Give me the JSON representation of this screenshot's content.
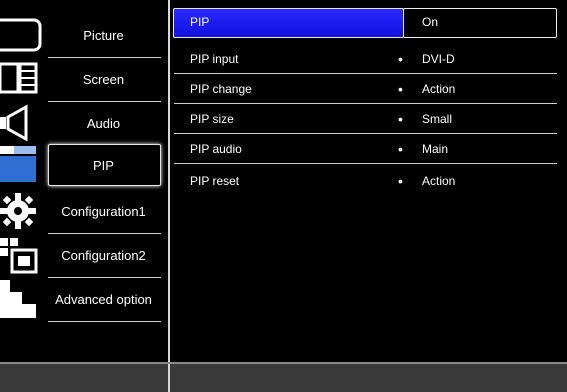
{
  "sidebar": {
    "items": [
      {
        "label": "Picture",
        "icon": "picture-icon"
      },
      {
        "label": "Screen",
        "icon": "screen-icon"
      },
      {
        "label": "Audio",
        "icon": "audio-icon"
      },
      {
        "label": "PIP",
        "icon": "pip-icon",
        "selected": true
      },
      {
        "label": "Configuration1",
        "icon": "gear-icon"
      },
      {
        "label": "Configuration2",
        "icon": "configuration2-icon"
      },
      {
        "label": "Advanced option",
        "icon": "advanced-option-icon"
      }
    ]
  },
  "menu": {
    "rows": [
      {
        "label": "PIP",
        "value": "On",
        "selected": true
      },
      {
        "label": "PIP input",
        "value": "DVI-D"
      },
      {
        "label": "PIP change",
        "value": "Action"
      },
      {
        "label": "PIP size",
        "value": "Small"
      },
      {
        "label": "PIP audio",
        "value": "Main"
      },
      {
        "label": "PIP reset",
        "value": "Action"
      }
    ],
    "bullet": "•"
  },
  "colors": {
    "highlight": "#1b1bff",
    "background": "#000000",
    "bottom_bar": "#3a3a3a"
  }
}
